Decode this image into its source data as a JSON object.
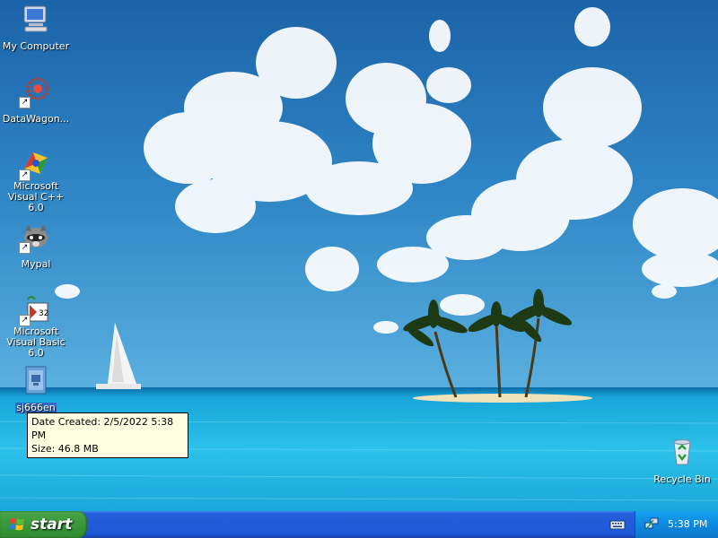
{
  "desktop_icons": [
    {
      "label": "My Computer"
    },
    {
      "label": "DataWagon..."
    },
    {
      "label": "Microsoft Visual C++ 6.0"
    },
    {
      "label": "Mypal"
    },
    {
      "label": "Microsoft Visual Basic 6.0"
    },
    {
      "label": "sj666en"
    },
    {
      "label": "Recycle Bin"
    }
  ],
  "tooltip": {
    "line1": "Date Created: 2/5/2022 5:38 PM",
    "line2": "Size: 46.8 MB"
  },
  "taskbar": {
    "start_label": "start",
    "clock": "5:38 PM"
  },
  "colors": {
    "taskbar_blue": "#245edb",
    "start_green": "#3c9a3c",
    "tray_blue": "#0e8ae0",
    "selection_blue": "#316ac5",
    "tooltip_bg": "#ffffe1"
  }
}
